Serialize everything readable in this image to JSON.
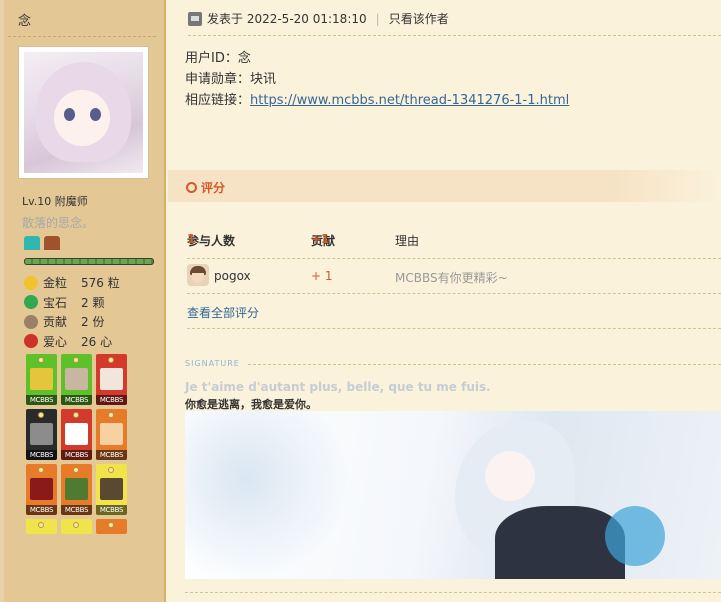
{
  "user": {
    "name": "念",
    "level": "Lv.10 附魔师",
    "motto": "散落的思念。",
    "stats": [
      {
        "icon": "gold-coin-icon",
        "label": "金粒",
        "value": "576 粒",
        "color": "#f2c12e"
      },
      {
        "icon": "gem-icon",
        "label": "宝石",
        "value": "2 颗",
        "color": "#2fa84f"
      },
      {
        "icon": "cookie-icon",
        "label": "贡献",
        "value": "2 份",
        "color": "#9b8066"
      },
      {
        "icon": "apple-icon",
        "label": "爱心",
        "value": "26 心",
        "color": "#d0302a"
      }
    ],
    "medals": [
      {
        "icon": "grass-block-medal-icon",
        "bg": "#5fc12a",
        "pic": "#e5c53a",
        "tag": "MCBBS"
      },
      {
        "icon": "book-feather-medal-icon",
        "bg": "#5fc12a",
        "pic": "#c9b6a0",
        "tag": "MCBBS"
      },
      {
        "icon": "java-cup-medal-icon",
        "bg": "#d33a2b",
        "pic": "#f0e6dc",
        "tag": "MCBBS"
      },
      {
        "icon": "stone-medal-icon",
        "bg": "#2a2a2a",
        "pic": "#8c8c8c",
        "tag": "MCBBS"
      },
      {
        "icon": "grid-medal-icon",
        "bg": "#d33a2b",
        "pic": "#ffffff",
        "tag": "MCBBS"
      },
      {
        "icon": "ten-years-medal-icon",
        "bg": "#e87b2a",
        "pic": "#f6d2a3",
        "tag": "MCBBS"
      },
      {
        "icon": "redstone-medal-icon",
        "bg": "#e87b2a",
        "pic": "#8a1a1a",
        "tag": "MCBBS"
      },
      {
        "icon": "leaves-medal-icon",
        "bg": "#e87b2a",
        "pic": "#4f7a2f",
        "tag": "MCBBS"
      },
      {
        "icon": "pickaxe-medal-icon",
        "bg": "#f1e34a",
        "pic": "#5a4830",
        "tag": "MCBBS"
      },
      {
        "icon": "yellow-medal-icon",
        "bg": "#f1e34a",
        "pic": "#f1e34a",
        "tag": ""
      },
      {
        "icon": "yellow-medal-icon",
        "bg": "#f1e34a",
        "pic": "#f1e34a",
        "tag": ""
      },
      {
        "icon": "orange-medal-icon",
        "bg": "#e87b2a",
        "pic": "#e87b2a",
        "tag": ""
      }
    ],
    "exp_progress": 1.0
  },
  "post": {
    "posted_label": "发表于 2022-5-20 01:18:10",
    "only_author": "只看该作者",
    "lines": [
      {
        "key": "用户ID：",
        "value": "念"
      },
      {
        "key": "申请勋章：",
        "value": "块讯"
      }
    ],
    "link_key": "相应链接：",
    "link_text": "https://www.mcbbs.net/thread-1341276-1-1.html"
  },
  "rating": {
    "title": "评分",
    "head_participants": "参与人数",
    "participants_count": "1",
    "head_contribution": "贡献",
    "contribution_total": "+1",
    "head_reason": "理由",
    "rows": [
      {
        "user": "pogox",
        "contribution": "+ 1",
        "reason": "MCBBS有你更精彩~"
      }
    ],
    "view_all": "查看全部评分"
  },
  "signature": {
    "label": "SIGNATURE",
    "quote": "Je t'aime d'autant plus, belle, que tu me fuis.",
    "cn": "你愈是逃离，我愈是爱你。"
  }
}
